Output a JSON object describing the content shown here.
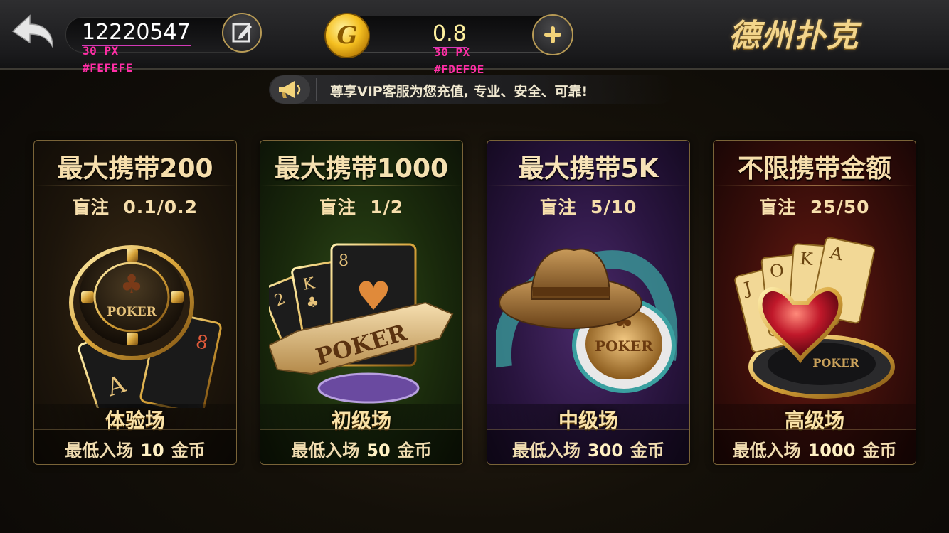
{
  "header": {
    "user_id": "12220547",
    "coins": "0.8",
    "logo_text": "德州扑克",
    "annotations": {
      "id_size": "30 PX",
      "id_color": "#FEFEFE",
      "coin_size": "30 PX",
      "coin_color": "#FDEF9E"
    },
    "coin_symbol": "G"
  },
  "notice": {
    "text": "尊享VIP客服为您充值, 专业、安全、可靠!"
  },
  "rooms": [
    {
      "title": "最大携带200",
      "blind_label": "盲注",
      "blind": "0.1/0.2",
      "name": "体验场",
      "min_label": "最低入场",
      "min": "10",
      "unit": "金币"
    },
    {
      "title": "最大携带1000",
      "blind_label": "盲注",
      "blind": "1/2",
      "name": "初级场",
      "min_label": "最低入场",
      "min": "50",
      "unit": "金币"
    },
    {
      "title": "最大携带5K",
      "blind_label": "盲注",
      "blind": "5/10",
      "name": "中级场",
      "min_label": "最低入场",
      "min": "300",
      "unit": "金币"
    },
    {
      "title": "不限携带金额",
      "blind_label": "盲注",
      "blind": "25/50",
      "name": "高级场",
      "min_label": "最低入场",
      "min": "1000",
      "unit": "金币"
    }
  ],
  "art_text": {
    "poker": "POKER",
    "card_letters": [
      "J",
      "O",
      "K",
      "A"
    ],
    "card_ranks": [
      "2",
      "K",
      "8",
      "A",
      "8"
    ]
  },
  "colors": {
    "gold": "#f6deac",
    "id_color": "#FEFEFE",
    "coin_color": "#FDEF9E",
    "annotation": "#ff2ea6"
  },
  "icons": {
    "back": "back-arrow-icon",
    "edit": "edit-icon",
    "coin": "coin-icon",
    "plus": "plus-icon",
    "notice": "megaphone-icon"
  }
}
